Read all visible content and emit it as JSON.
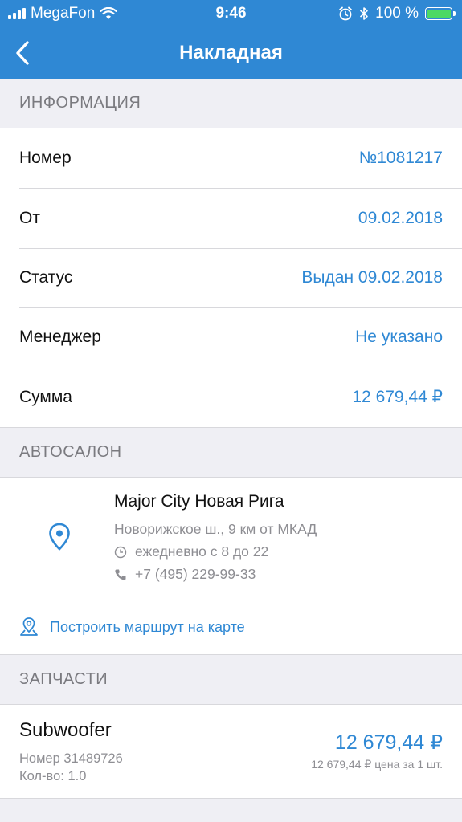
{
  "status_bar": {
    "carrier": "MegaFon",
    "time": "9:46",
    "battery": "100 %",
    "battery_level": 1.0,
    "icons": [
      "signal-icon",
      "wifi-icon",
      "alarm-icon",
      "bluetooth-icon",
      "battery-icon"
    ]
  },
  "nav": {
    "back_icon": "chevron-left-icon",
    "title": "Накладная"
  },
  "colors": {
    "accent": "#2f88d4",
    "background": "#efeff4",
    "secondary_text": "#8e8e93",
    "battery": "#4cd964"
  },
  "info": {
    "header": "ИНФОРМАЦИЯ",
    "rows": [
      {
        "label": "Номер",
        "value": "№1081217"
      },
      {
        "label": "От",
        "value": "09.02.2018"
      },
      {
        "label": "Статус",
        "value": "Выдан 09.02.2018"
      },
      {
        "label": "Менеджер",
        "value": "Не указано"
      },
      {
        "label": "Сумма",
        "value": "12 679,44 ₽"
      }
    ]
  },
  "salon": {
    "header": "АВТОСАЛОН",
    "name": "Major City Новая Рига",
    "address": "Новорижское ш., 9 км от МКАД",
    "hours": "ежедневно с 8 до 22",
    "phone": "+7 (495) 229-99-33",
    "route_label": "Построить маршрут на карте"
  },
  "parts": {
    "header": "ЗАПЧАСТИ",
    "items": [
      {
        "name": "Subwoofer",
        "number": "Номер 31489726",
        "quantity": "Кол-во: 1.0",
        "price": "12 679,44 ₽",
        "unit_price": "12 679,44 ₽ цена за 1 шт."
      }
    ]
  }
}
